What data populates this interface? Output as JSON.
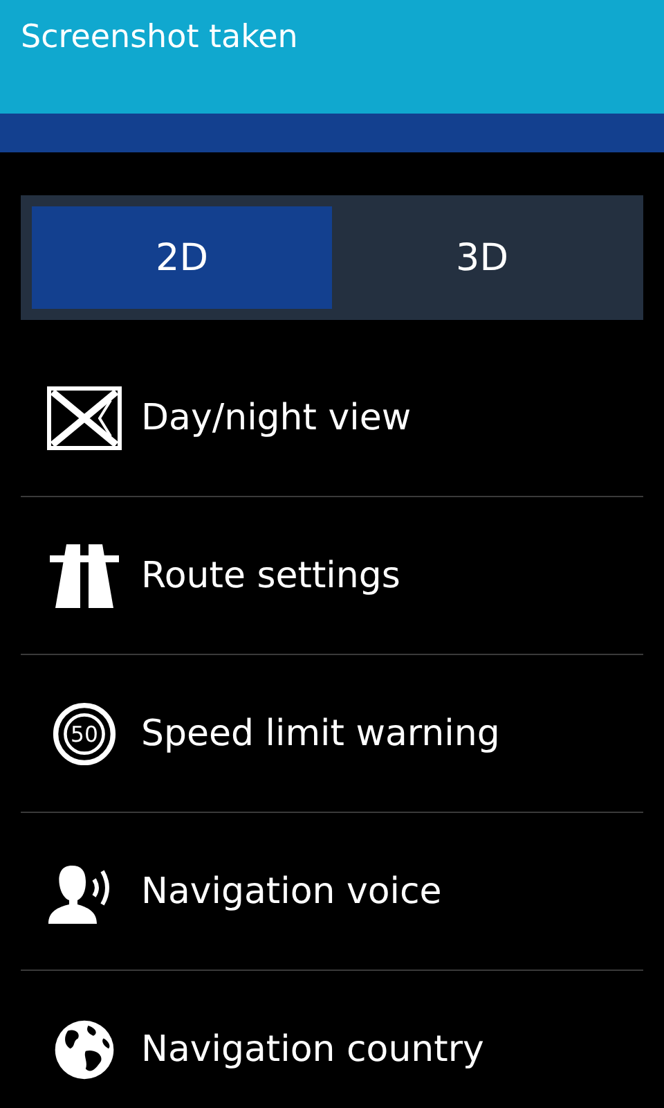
{
  "notification": {
    "text": "Screenshot taken"
  },
  "view_toggle": [
    {
      "label": "2D",
      "selected": true
    },
    {
      "label": "3D",
      "selected": false
    }
  ],
  "items": [
    {
      "kind": "day-night",
      "label": "Day/night view"
    },
    {
      "kind": "route",
      "label": "Route settings"
    },
    {
      "kind": "speed",
      "label": "Speed limit warning",
      "icon_text": "50"
    },
    {
      "kind": "voice",
      "label": "Navigation voice"
    },
    {
      "kind": "globe",
      "label": "Navigation country"
    }
  ]
}
